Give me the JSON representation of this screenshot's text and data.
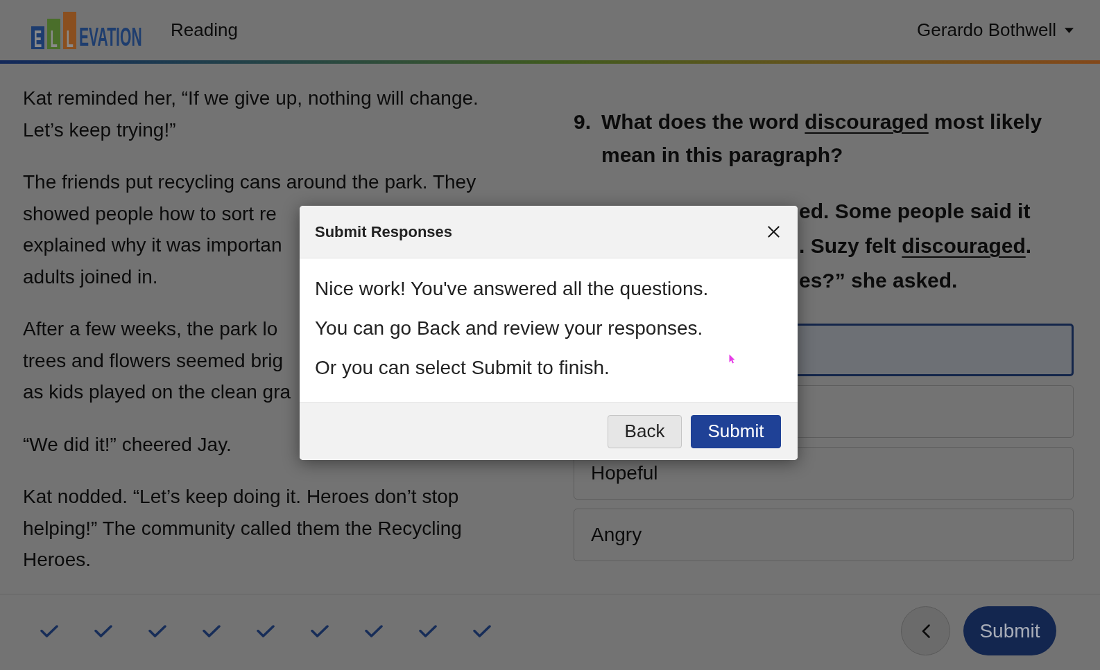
{
  "header": {
    "logo": {
      "tiles": [
        {
          "letter": "E",
          "color": "#1d3c6e"
        },
        {
          "letter": "L",
          "color": "#4a6e2a"
        },
        {
          "letter": "L",
          "color": "#8a4f1f"
        }
      ],
      "wordmark": "EVATION"
    },
    "section_title": "Reading",
    "user_name": "Gerardo Bothwell"
  },
  "passage": [
    {
      "lines": [
        "Kat reminded her, “If we give up, nothing will change.",
        "Let’s keep trying!”"
      ]
    },
    {
      "lines": [
        "The friends put recycling cans around the park. They",
        "showed people how to sort re",
        "explained why it was importan",
        "adults joined in."
      ]
    },
    {
      "lines": [
        "After a few weeks, the park lo",
        "trees and flowers seemed brig",
        "as kids played on the clean gra"
      ]
    },
    {
      "lines": [
        "“We did it!” cheered Jay."
      ]
    },
    {
      "lines": [
        "Kat nodded. “Let’s keep doing it. Heroes don’t stop",
        "helping!” The community called them the Recycling",
        "Heroes."
      ]
    }
  ],
  "question": {
    "number": "9.",
    "prompt": [
      {
        "text": "What does the word ",
        "kind": "plain"
      },
      {
        "text": "discouraged",
        "kind": "term"
      },
      {
        "text": " most likely mean in this paragraph?",
        "kind": "plain"
      }
    ],
    "excerpt_lines": [
      [
        {
          "text": "ed. Some people said it",
          "kind": "plain"
        }
      ],
      [
        {
          "text": ". Suzy felt ",
          "kind": "plain"
        },
        {
          "text": "discouraged",
          "kind": "term"
        },
        {
          "text": ".",
          "kind": "plain"
        }
      ],
      [
        {
          "text": "es?” she asked.",
          "kind": "plain"
        }
      ]
    ],
    "options": [
      {
        "selected": true
      },
      {
        "selected": false
      },
      {
        "label": "Hopeful",
        "selected": false
      },
      {
        "label": "Angry",
        "selected": false
      }
    ]
  },
  "footer": {
    "question_nav": [
      {
        "answered": true
      },
      {
        "answered": true
      },
      {
        "answered": true
      },
      {
        "answered": true
      },
      {
        "answered": true
      },
      {
        "answered": true
      },
      {
        "answered": true
      },
      {
        "answered": true
      },
      {
        "answered": true
      }
    ],
    "submit": "Submit"
  },
  "dialog": {
    "title": "Submit Responses",
    "messages": [
      "Nice work! You've answered all the questions.",
      "You can go Back and review your responses.",
      "Or you can select Submit to finish."
    ],
    "buttons": [
      {
        "label": "Back",
        "kind": "secondary"
      },
      {
        "label": "Submit",
        "kind": "primary"
      }
    ]
  }
}
